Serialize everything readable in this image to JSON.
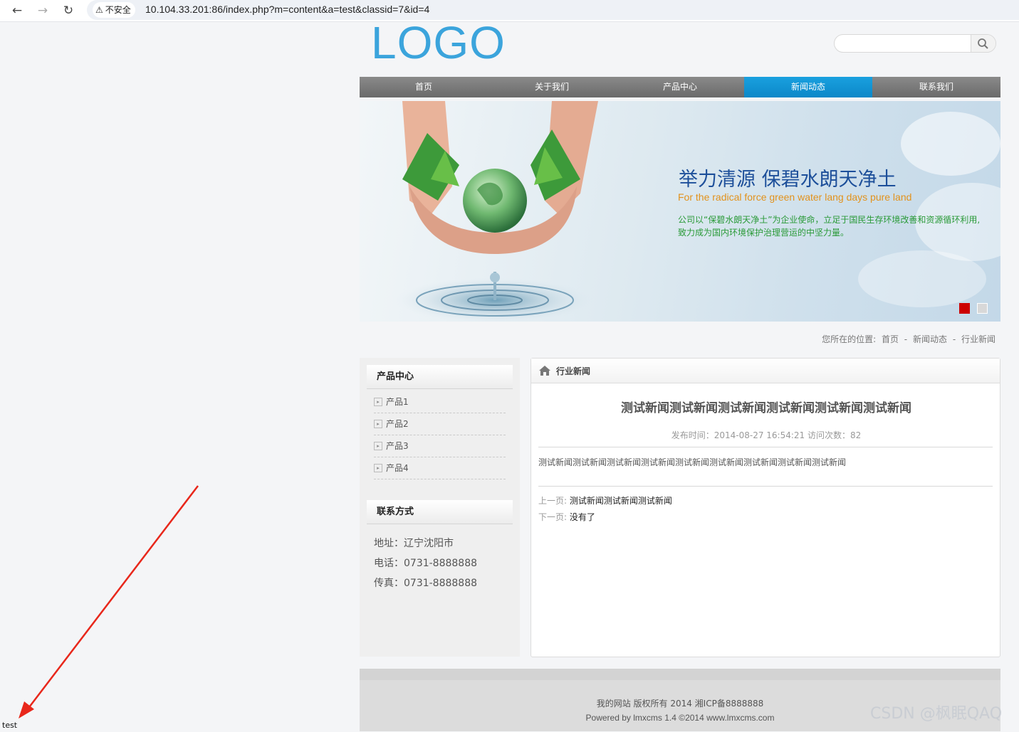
{
  "browser": {
    "security_label": "不安全",
    "url": "10.104.33.201:86/index.php?m=content&a=test&classid=7&id=4"
  },
  "site": {
    "logo": "LOGO",
    "search": {
      "placeholder": ""
    },
    "nav": [
      "首页",
      "关于我们",
      "产品中心",
      "新闻动态",
      "联系我们"
    ],
    "nav_active_index": 3,
    "banner": {
      "title": "举力清源 保碧水朗天净土",
      "subtitle": "For the radical force green water lang days pure land",
      "desc_line1": "公司以“保碧水朗天净土”为企业使命，立足于国民生存环境改善和资源循环利用,",
      "desc_line2": "致力成为国内环境保护治理营运的中坚力量。",
      "slides": 2,
      "active_slide": 1
    },
    "breadcrumb": {
      "label": "您所在的位置:",
      "items": [
        "首页",
        "新闻动态",
        "行业新闻"
      ],
      "separator": "-"
    },
    "sidebar": {
      "products_heading": "产品中心",
      "products": [
        "产品1",
        "产品2",
        "产品3",
        "产品4"
      ],
      "contact_heading": "联系方式",
      "contact": [
        "地址：辽宁沈阳市",
        "电话：0731-8888888",
        "传真：0731-8888888"
      ]
    },
    "article": {
      "section": "行业新闻",
      "title": "测试新闻测试新闻测试新闻测试新闻测试新闻测试新闻",
      "meta": "发布时间：2014-08-27 16:54:21  访问次数：82",
      "body": "测试新闻测试新闻测试新闻测试新闻测试新闻测试新闻测试新闻测试新闻测试新闻",
      "prev_label": "上一页:",
      "prev_value": "测试新闻测试新闻测试新闻",
      "next_label": "下一页:",
      "next_value": "没有了"
    },
    "footer": {
      "line1": "我的网站 版权所有 2014 湘ICP备8888888",
      "line2": "Powered by lmxcms 1.4 ©2014 www.lmxcms.com"
    }
  },
  "status_text": "test",
  "watermark": "CSDN @枫眠QAQ",
  "colors": {
    "logo": "#3ba4dc",
    "nav_active": "#0e92d2",
    "banner_title": "#1d4f9a",
    "banner_subtitle": "#e2921c",
    "banner_desc": "#2a9a38",
    "annotation_arrow": "#e8271b"
  }
}
